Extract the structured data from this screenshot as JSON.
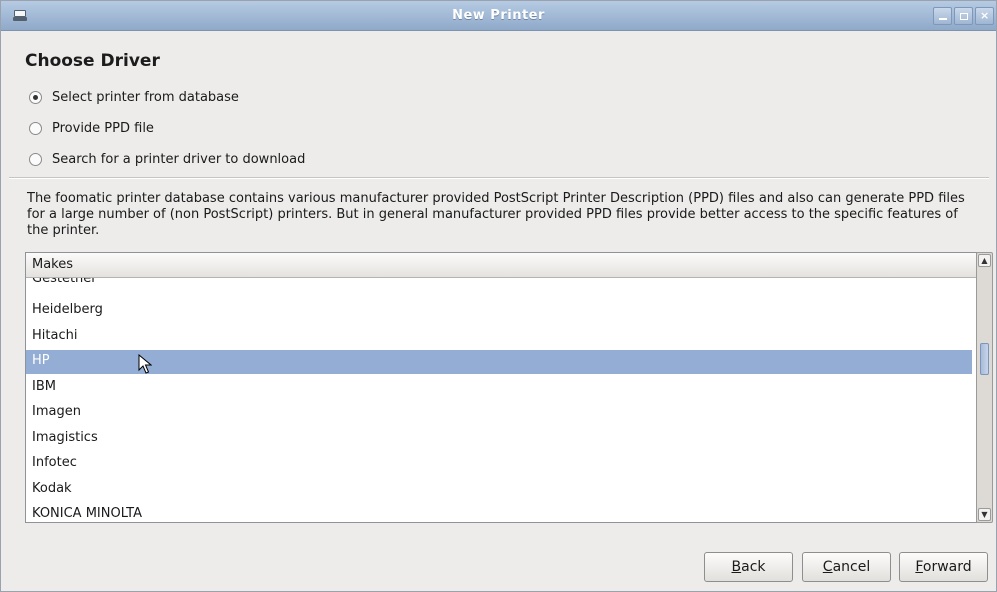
{
  "window": {
    "title": "New Printer"
  },
  "page": {
    "heading": "Choose Driver"
  },
  "options": [
    {
      "label": "Select printer from database",
      "selected": true
    },
    {
      "label": "Provide PPD file",
      "selected": false
    },
    {
      "label": "Search for a printer driver to download",
      "selected": false
    }
  ],
  "description": "The foomatic printer database contains various manufacturer provided PostScript Printer Description (PPD) files and also can generate PPD files for a large number of (non PostScript) printers. But in general manufacturer provided PPD files provide better access to the specific features of the printer.",
  "makes_list": {
    "header": "Makes",
    "items": [
      "Gestetner",
      "Heidelberg",
      "Hitachi",
      "HP",
      "IBM",
      "Imagen",
      "Imagistics",
      "Infotec",
      "Kodak",
      "KONICA MINOLTA"
    ],
    "selected": "HP"
  },
  "buttons": {
    "back_label": "Back",
    "back_mnemonic": "B",
    "back_rest": "ack",
    "cancel_label": "Cancel",
    "cancel_mnemonic": "C",
    "cancel_rest": "ancel",
    "forward_label": "Forward",
    "forward_mnemonic": "F",
    "forward_rest": "orward"
  },
  "colors": {
    "titlebar": "#9fb6d3",
    "selection": "#93add4",
    "window_bg": "#edeceb"
  }
}
